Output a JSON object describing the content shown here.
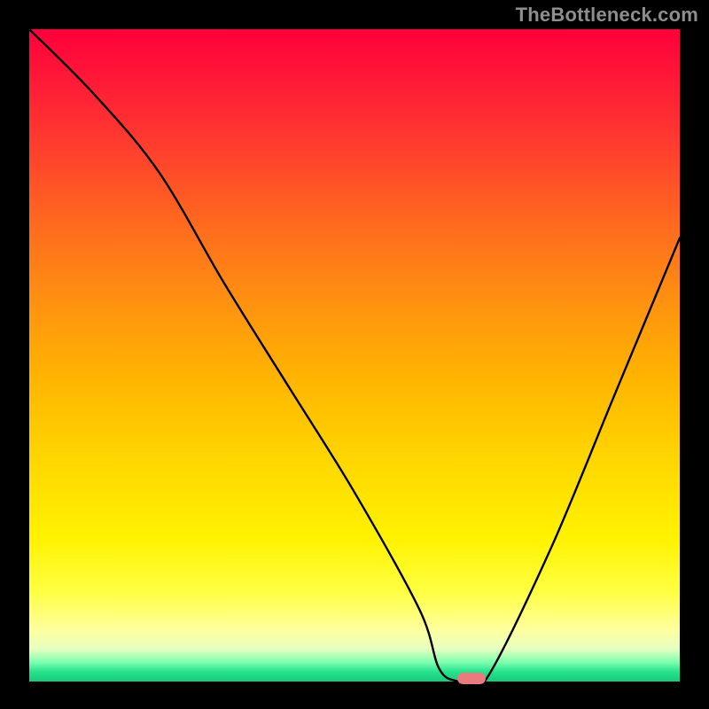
{
  "watermark": "TheBottleneck.com",
  "chart_data": {
    "type": "line",
    "title": "",
    "xlabel": "",
    "ylabel": "",
    "xlim": [
      0,
      100
    ],
    "ylim": [
      0,
      100
    ],
    "grid": false,
    "background_gradient": [
      "#ff003b",
      "#ffd600",
      "#ffff9e",
      "#18c978"
    ],
    "series": [
      {
        "name": "bottleneck-curve",
        "x": [
          0,
          10,
          20,
          30,
          40,
          50,
          60,
          63,
          66,
          70,
          80,
          90,
          100
        ],
        "y": [
          100,
          90,
          78,
          61,
          45,
          29,
          11,
          2,
          0,
          0,
          20,
          44,
          68
        ]
      }
    ],
    "marker": {
      "name": "optimal-marker",
      "x": 68,
      "y": 0,
      "color": "#e97a7e"
    }
  }
}
